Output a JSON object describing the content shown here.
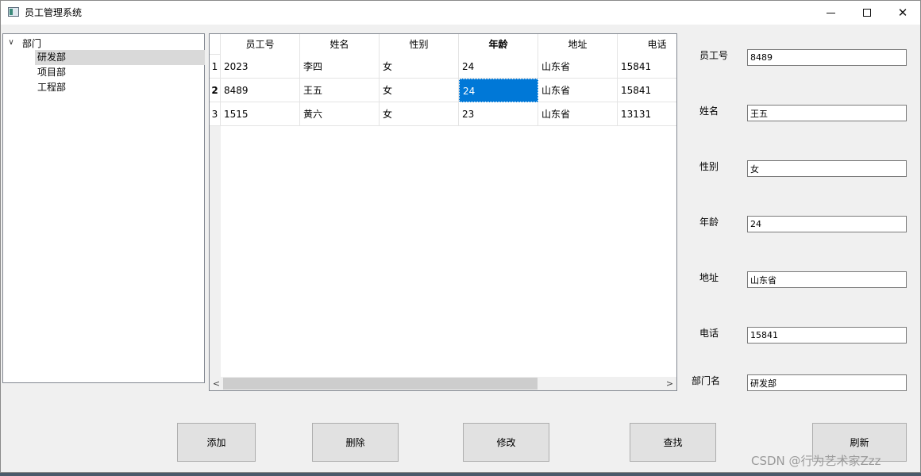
{
  "window": {
    "title": "员工管理系统",
    "minimize_symbol": "",
    "close_symbol": "✕"
  },
  "tree": {
    "root_label": "部门",
    "expand_symbol": "∨",
    "children": [
      "研发部",
      "项目部",
      "工程部"
    ],
    "selected_index": 0
  },
  "table": {
    "columns": [
      "员工号",
      "姓名",
      "性别",
      "年龄",
      "地址",
      "电话"
    ],
    "row_numbers": [
      "1",
      "2",
      "3"
    ],
    "rows": [
      [
        "2023",
        "李四",
        "女",
        "24",
        "山东省",
        "15841"
      ],
      [
        "8489",
        "王五",
        "女",
        "24",
        "山东省",
        "15841"
      ],
      [
        "1515",
        "黄六",
        "女",
        "23",
        "山东省",
        "13131"
      ]
    ],
    "current_row": 1,
    "current_column": 3,
    "scroll_left_symbol": "<",
    "scroll_right_symbol": ">"
  },
  "form": {
    "fields": [
      {
        "label": "员工号",
        "value": "8489"
      },
      {
        "label": "姓名",
        "value": "王五"
      },
      {
        "label": "性别",
        "value": "女"
      },
      {
        "label": "年龄",
        "value": "24"
      },
      {
        "label": "地址",
        "value": "山东省"
      },
      {
        "label": "电话",
        "value": "15841"
      },
      {
        "label": "部门名",
        "value": "研发部"
      }
    ]
  },
  "buttons": {
    "add": "添加",
    "delete": "删除",
    "modify": "修改",
    "search": "查找",
    "refresh": "刷新"
  },
  "watermark": "CSDN @行为艺术家Zzz"
}
